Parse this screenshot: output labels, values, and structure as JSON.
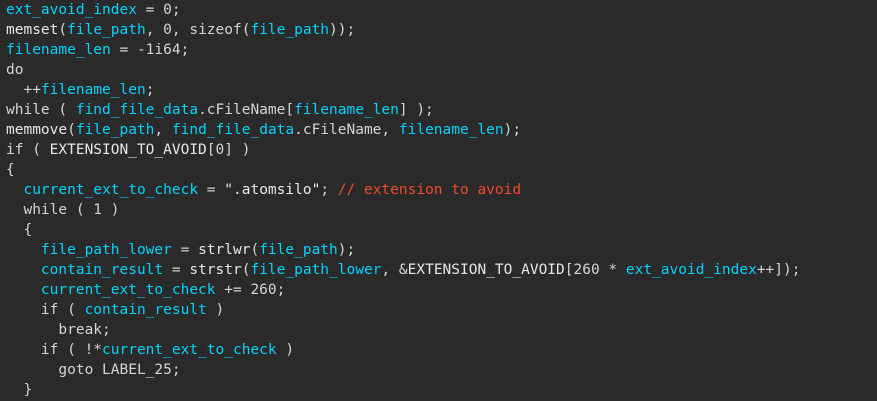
{
  "code_lines": [
    [
      {
        "text": "ext_avoid_index",
        "kind": "var"
      },
      {
        "text": " = 0;",
        "kind": "punct"
      }
    ],
    [
      {
        "text": "memset",
        "kind": "fn"
      },
      {
        "text": "(",
        "kind": "punct"
      },
      {
        "text": "file_path",
        "kind": "var"
      },
      {
        "text": ", 0, sizeof(",
        "kind": "punct"
      },
      {
        "text": "file_path",
        "kind": "var"
      },
      {
        "text": "));",
        "kind": "punct"
      }
    ],
    [
      {
        "text": "filename_len",
        "kind": "var"
      },
      {
        "text": " = -1i64;",
        "kind": "punct"
      }
    ],
    [
      {
        "text": "do",
        "kind": "kw"
      }
    ],
    [
      {
        "text": "  ++",
        "kind": "punct"
      },
      {
        "text": "filename_len",
        "kind": "var"
      },
      {
        "text": ";",
        "kind": "punct"
      }
    ],
    [
      {
        "text": "while ( ",
        "kind": "kw"
      },
      {
        "text": "find_file_data",
        "kind": "var"
      },
      {
        "text": ".cFileName[",
        "kind": "punct"
      },
      {
        "text": "filename_len",
        "kind": "var"
      },
      {
        "text": "] );",
        "kind": "punct"
      }
    ],
    [
      {
        "text": "memmove",
        "kind": "fn"
      },
      {
        "text": "(",
        "kind": "punct"
      },
      {
        "text": "file_path",
        "kind": "var"
      },
      {
        "text": ", ",
        "kind": "punct"
      },
      {
        "text": "find_file_data",
        "kind": "var"
      },
      {
        "text": ".cFileName, ",
        "kind": "punct"
      },
      {
        "text": "filename_len",
        "kind": "var"
      },
      {
        "text": ");",
        "kind": "punct"
      }
    ],
    [
      {
        "text": "if ( ",
        "kind": "kw"
      },
      {
        "text": "EXTENSION_TO_AVOID",
        "kind": "mac"
      },
      {
        "text": "[0] )",
        "kind": "punct"
      }
    ],
    [
      {
        "text": "{",
        "kind": "punct"
      }
    ],
    [
      {
        "text": "  ",
        "kind": "punct"
      },
      {
        "text": "current_ext_to_check",
        "kind": "var"
      },
      {
        "text": " = ",
        "kind": "punct"
      },
      {
        "text": "\".atomsilo\"",
        "kind": "str"
      },
      {
        "text": "; ",
        "kind": "punct"
      },
      {
        "text": "// extension to avoid",
        "kind": "cmt"
      }
    ],
    [
      {
        "text": "  while ( 1 )",
        "kind": "kw"
      }
    ],
    [
      {
        "text": "  {",
        "kind": "punct"
      }
    ],
    [
      {
        "text": "    ",
        "kind": "punct"
      },
      {
        "text": "file_path_lower",
        "kind": "var"
      },
      {
        "text": " = ",
        "kind": "punct"
      },
      {
        "text": "strlwr",
        "kind": "fn"
      },
      {
        "text": "(",
        "kind": "punct"
      },
      {
        "text": "file_path",
        "kind": "var"
      },
      {
        "text": ");",
        "kind": "punct"
      }
    ],
    [
      {
        "text": "    ",
        "kind": "punct"
      },
      {
        "text": "contain_result",
        "kind": "var"
      },
      {
        "text": " = ",
        "kind": "punct"
      },
      {
        "text": "strstr",
        "kind": "fn"
      },
      {
        "text": "(",
        "kind": "punct"
      },
      {
        "text": "file_path_lower",
        "kind": "var"
      },
      {
        "text": ", &",
        "kind": "punct"
      },
      {
        "text": "EXTENSION_TO_AVOID",
        "kind": "mac"
      },
      {
        "text": "[260 * ",
        "kind": "punct"
      },
      {
        "text": "ext_avoid_index",
        "kind": "var"
      },
      {
        "text": "++]);",
        "kind": "punct"
      }
    ],
    [
      {
        "text": "    ",
        "kind": "punct"
      },
      {
        "text": "current_ext_to_check",
        "kind": "var"
      },
      {
        "text": " += 260;",
        "kind": "punct"
      }
    ],
    [
      {
        "text": "    if ( ",
        "kind": "kw"
      },
      {
        "text": "contain_result",
        "kind": "var"
      },
      {
        "text": " )",
        "kind": "punct"
      }
    ],
    [
      {
        "text": "      break;",
        "kind": "kw"
      }
    ],
    [
      {
        "text": "    if ( !*",
        "kind": "kw"
      },
      {
        "text": "current_ext_to_check",
        "kind": "var"
      },
      {
        "text": " )",
        "kind": "punct"
      }
    ],
    [
      {
        "text": "      goto LABEL_25;",
        "kind": "kw"
      }
    ],
    [
      {
        "text": "  }",
        "kind": "punct"
      }
    ]
  ],
  "colors": {
    "background": "#2a2a2a",
    "identifier": "#00d4ff",
    "keyword": "#d4d4d4",
    "comment": "#f04a2a"
  }
}
